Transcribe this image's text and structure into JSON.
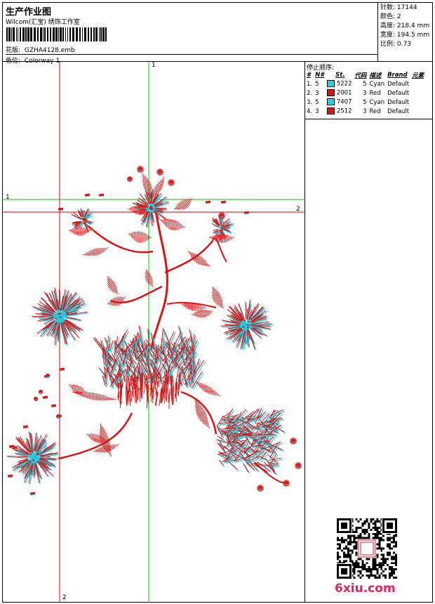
{
  "header": {
    "title": "生产作业图",
    "subtitle": "Wilcom(汇宝) 绣饰工作室",
    "file_label": "花版:",
    "file_name": "GZHA4128.emb",
    "colorway_label": "色位:",
    "colorway_name": "Colorway 1"
  },
  "stats": {
    "stitches_label": "针数:",
    "stitches": "17144",
    "colors_label": "颜色:",
    "colors": "2",
    "height_label": "高度:",
    "height": "218.4 mm",
    "width_label": "宽度:",
    "width": "194.5 mm",
    "scale_label": "比例:",
    "scale": "0.73"
  },
  "stop_sequence": {
    "title": "停止顺序:",
    "columns": [
      "#",
      "N#",
      "St.",
      "代码",
      "描述",
      "Brand",
      "元素"
    ],
    "rows": [
      {
        "idx": "1.",
        "n": "5",
        "color": "#22d3e0",
        "st": "5222",
        "code": "5",
        "desc": "Cyan",
        "brand": "Default"
      },
      {
        "idx": "2.",
        "n": "3",
        "color": "#e01010",
        "st": "2001",
        "code": "3",
        "desc": "Red",
        "brand": "Default"
      },
      {
        "idx": "3.",
        "n": "5",
        "color": "#22d3e0",
        "st": "7407",
        "code": "5",
        "desc": "Cyan",
        "brand": "Default"
      },
      {
        "idx": "4.",
        "n": "3",
        "color": "#e01010",
        "st": "2512",
        "code": "3",
        "desc": "Red",
        "brand": "Default"
      }
    ]
  },
  "guides": {
    "green_v_label": "1",
    "green_h_label": "1",
    "red_h_label": "2",
    "red_v_label": "2",
    "green_color": "#00c800",
    "red_color": "#e00000"
  },
  "watermark": "6xiu.com",
  "colors": {
    "thread_red": "#e01010",
    "thread_cyan": "#22c8dc"
  }
}
